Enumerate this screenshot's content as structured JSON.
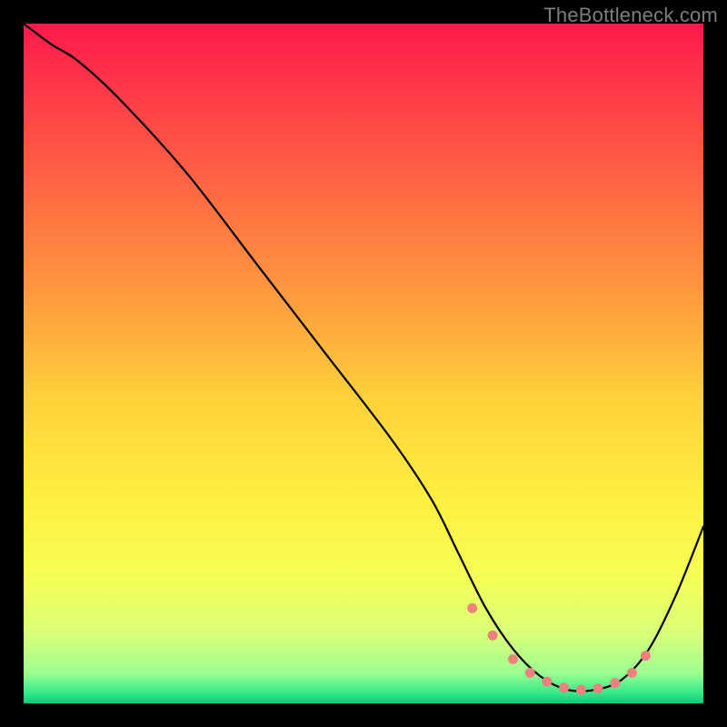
{
  "watermark": "TheBottleneck.com",
  "chart_data": {
    "type": "line",
    "title": "",
    "xlabel": "",
    "ylabel": "",
    "xlim": [
      0,
      100
    ],
    "ylim": [
      0,
      100
    ],
    "axes_visible": false,
    "background": {
      "type": "vertical-gradient",
      "stops": [
        {
          "pos": 0.0,
          "color": "#ff1a4b"
        },
        {
          "pos": 0.2,
          "color": "#ff5a45"
        },
        {
          "pos": 0.4,
          "color": "#ff9a3f"
        },
        {
          "pos": 0.55,
          "color": "#ffd03a"
        },
        {
          "pos": 0.7,
          "color": "#ffef3f"
        },
        {
          "pos": 0.82,
          "color": "#f4ff58"
        },
        {
          "pos": 0.9,
          "color": "#d7ff7a"
        },
        {
          "pos": 0.955,
          "color": "#9cff90"
        },
        {
          "pos": 0.985,
          "color": "#34e989"
        },
        {
          "pos": 1.0,
          "color": "#10c877"
        }
      ]
    },
    "series": [
      {
        "name": "bottleneck-curve",
        "stroke": "#000000",
        "stroke_width": 2.2,
        "x": [
          0.0,
          4.0,
          8.0,
          14.0,
          24.0,
          34.0,
          44.0,
          54.0,
          60.0,
          64.0,
          68.0,
          72.0,
          76.0,
          80.0,
          84.0,
          88.0,
          92.0,
          96.0,
          100.0
        ],
        "y": [
          100.0,
          97.0,
          94.5,
          89.0,
          78.0,
          65.0,
          52.0,
          39.0,
          30.0,
          22.0,
          14.0,
          8.0,
          4.0,
          2.0,
          2.0,
          3.5,
          8.0,
          16.0,
          26.0
        ]
      }
    ],
    "markers": {
      "name": "min-region-dots",
      "color": "#f08080",
      "radius_px": 5.5,
      "x": [
        66.0,
        69.0,
        72.0,
        74.5,
        77.0,
        79.5,
        82.0,
        84.5,
        87.0,
        89.5,
        91.5
      ],
      "y": [
        14.0,
        10.0,
        6.5,
        4.5,
        3.2,
        2.3,
        2.0,
        2.2,
        3.0,
        4.5,
        7.0
      ]
    }
  }
}
